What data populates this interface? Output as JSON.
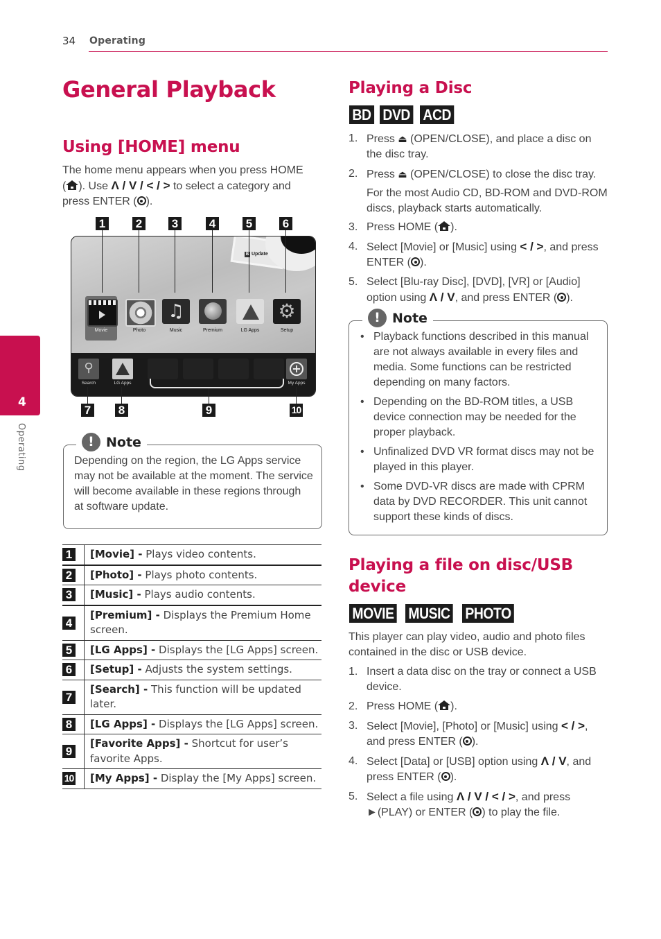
{
  "header": {
    "page_number": "34",
    "section": "Operating"
  },
  "side_tab": {
    "chapter_number": "4",
    "chapter_label": "Operating"
  },
  "title": "General Playback",
  "home_menu": {
    "heading": "Using [HOME] menu",
    "intro_1": "The home menu appears when you press HOME",
    "intro_2a": "(",
    "intro_2b": "). Use ",
    "intro_2_symbols": "Λ / V / < / >",
    "intro_2c": " to select a category and",
    "intro_3a": "press ENTER (",
    "intro_3b": ").",
    "screen": {
      "update_label": "Update",
      "top_items": [
        "Movie",
        "Photo",
        "Music",
        "Premium",
        "LG Apps",
        "Setup"
      ],
      "bottom_items": {
        "search": "Search",
        "lg_apps": "LG Apps",
        "my_apps": "My Apps"
      },
      "callouts_top": [
        "1",
        "2",
        "3",
        "4",
        "5",
        "6"
      ],
      "callouts_bottom": [
        "7",
        "8",
        "9",
        "10"
      ]
    },
    "note": {
      "title": "Note",
      "text": "Depending on the region, the LG Apps service may not be available at the moment. The service will become available in these regions through at software update."
    },
    "legend": [
      {
        "num": "1",
        "name": "[Movie] -",
        "desc": " Plays video contents."
      },
      {
        "num": "2",
        "name": "[Photo] -",
        "desc": " Plays photo contents."
      },
      {
        "num": "3",
        "name": "[Music] -",
        "desc": " Plays audio contents."
      },
      {
        "num": "4",
        "name": "[Premium] -",
        "desc": " Displays the Premium Home screen."
      },
      {
        "num": "5",
        "name": "[LG Apps] -",
        "desc": " Displays the [LG Apps] screen."
      },
      {
        "num": "6",
        "name": "[Setup] -",
        "desc": " Adjusts the system settings."
      },
      {
        "num": "7",
        "name": "[Search] -",
        "desc": " This function will be updated later."
      },
      {
        "num": "8",
        "name": "[LG Apps] -",
        "desc": " Displays the [LG Apps] screen."
      },
      {
        "num": "9",
        "name": "[Favorite Apps] -",
        "desc": " Shortcut for user’s favorite Apps."
      },
      {
        "num": "10",
        "name": "[My Apps] -",
        "desc": " Display the [My Apps] screen."
      }
    ]
  },
  "playing_disc": {
    "heading": "Playing a Disc",
    "badges": [
      "BD",
      "DVD",
      "ACD"
    ],
    "steps": [
      {
        "n": "1.",
        "pre": "Press ",
        "post": " (OPEN/CLOSE), and place a disc on the disc tray."
      },
      {
        "n": "2.",
        "pre": "Press ",
        "post": " (OPEN/CLOSE) to close the disc tray."
      },
      {
        "n": "3.",
        "pre": "Press HOME (",
        "post": ")."
      },
      {
        "n": "4.",
        "pre": "Select [Movie] or [Music] using ",
        "sym": "< / >",
        "post": ", and press ENTER (",
        "end": ")."
      },
      {
        "n": "5.",
        "pre": "Select [Blu-ray Disc], [DVD], [VR] or [Audio] option using ",
        "sym": "Λ / V",
        "post": ", and press ENTER (",
        "end": ")."
      }
    ],
    "step2_followup": "For the most Audio CD, BD-ROM and DVD-ROM discs, playback starts automatically.",
    "note": {
      "title": "Note",
      "bullets": [
        "Playback functions described in this manual are not always available in every files and media. Some functions can be restricted depending on many factors.",
        "Depending on the BD-ROM titles, a USB device connection may be needed for the proper playback.",
        "Unfinalized DVD VR format discs may not be played in this player.",
        "Some DVD-VR discs are made with CPRM data by DVD RECORDER. This unit cannot support these kinds of discs."
      ]
    }
  },
  "playing_file": {
    "heading": "Playing a file on disc/USB device",
    "badges": [
      "MOVIE",
      "MUSIC",
      "PHOTO"
    ],
    "intro": "This player can play video, audio and photo files contained in the disc or USB device.",
    "steps": [
      {
        "n": "1.",
        "text": "Insert a data disc on the tray or connect a USB device."
      },
      {
        "n": "2.",
        "pre": "Press HOME (",
        "post": ")."
      },
      {
        "n": "3.",
        "pre": "Select [Movie], [Photo] or [Music] using ",
        "sym": "< / >",
        "post": ", and press ENTER (",
        "end": ")."
      },
      {
        "n": "4.",
        "pre": "Select [Data] or [USB] option using ",
        "sym": "Λ / V",
        "post": ", and press ENTER (",
        "end": ")."
      },
      {
        "n": "5.",
        "pre": "Select a file using ",
        "sym": "Λ / V / < / >",
        "post": ", and press ►(PLAY) or ENTER (",
        "end": ") to play the file."
      }
    ]
  },
  "colors": {
    "accent": "#c8104f",
    "badge_bg": "#1c1c1c",
    "note_icon": "#666666"
  }
}
